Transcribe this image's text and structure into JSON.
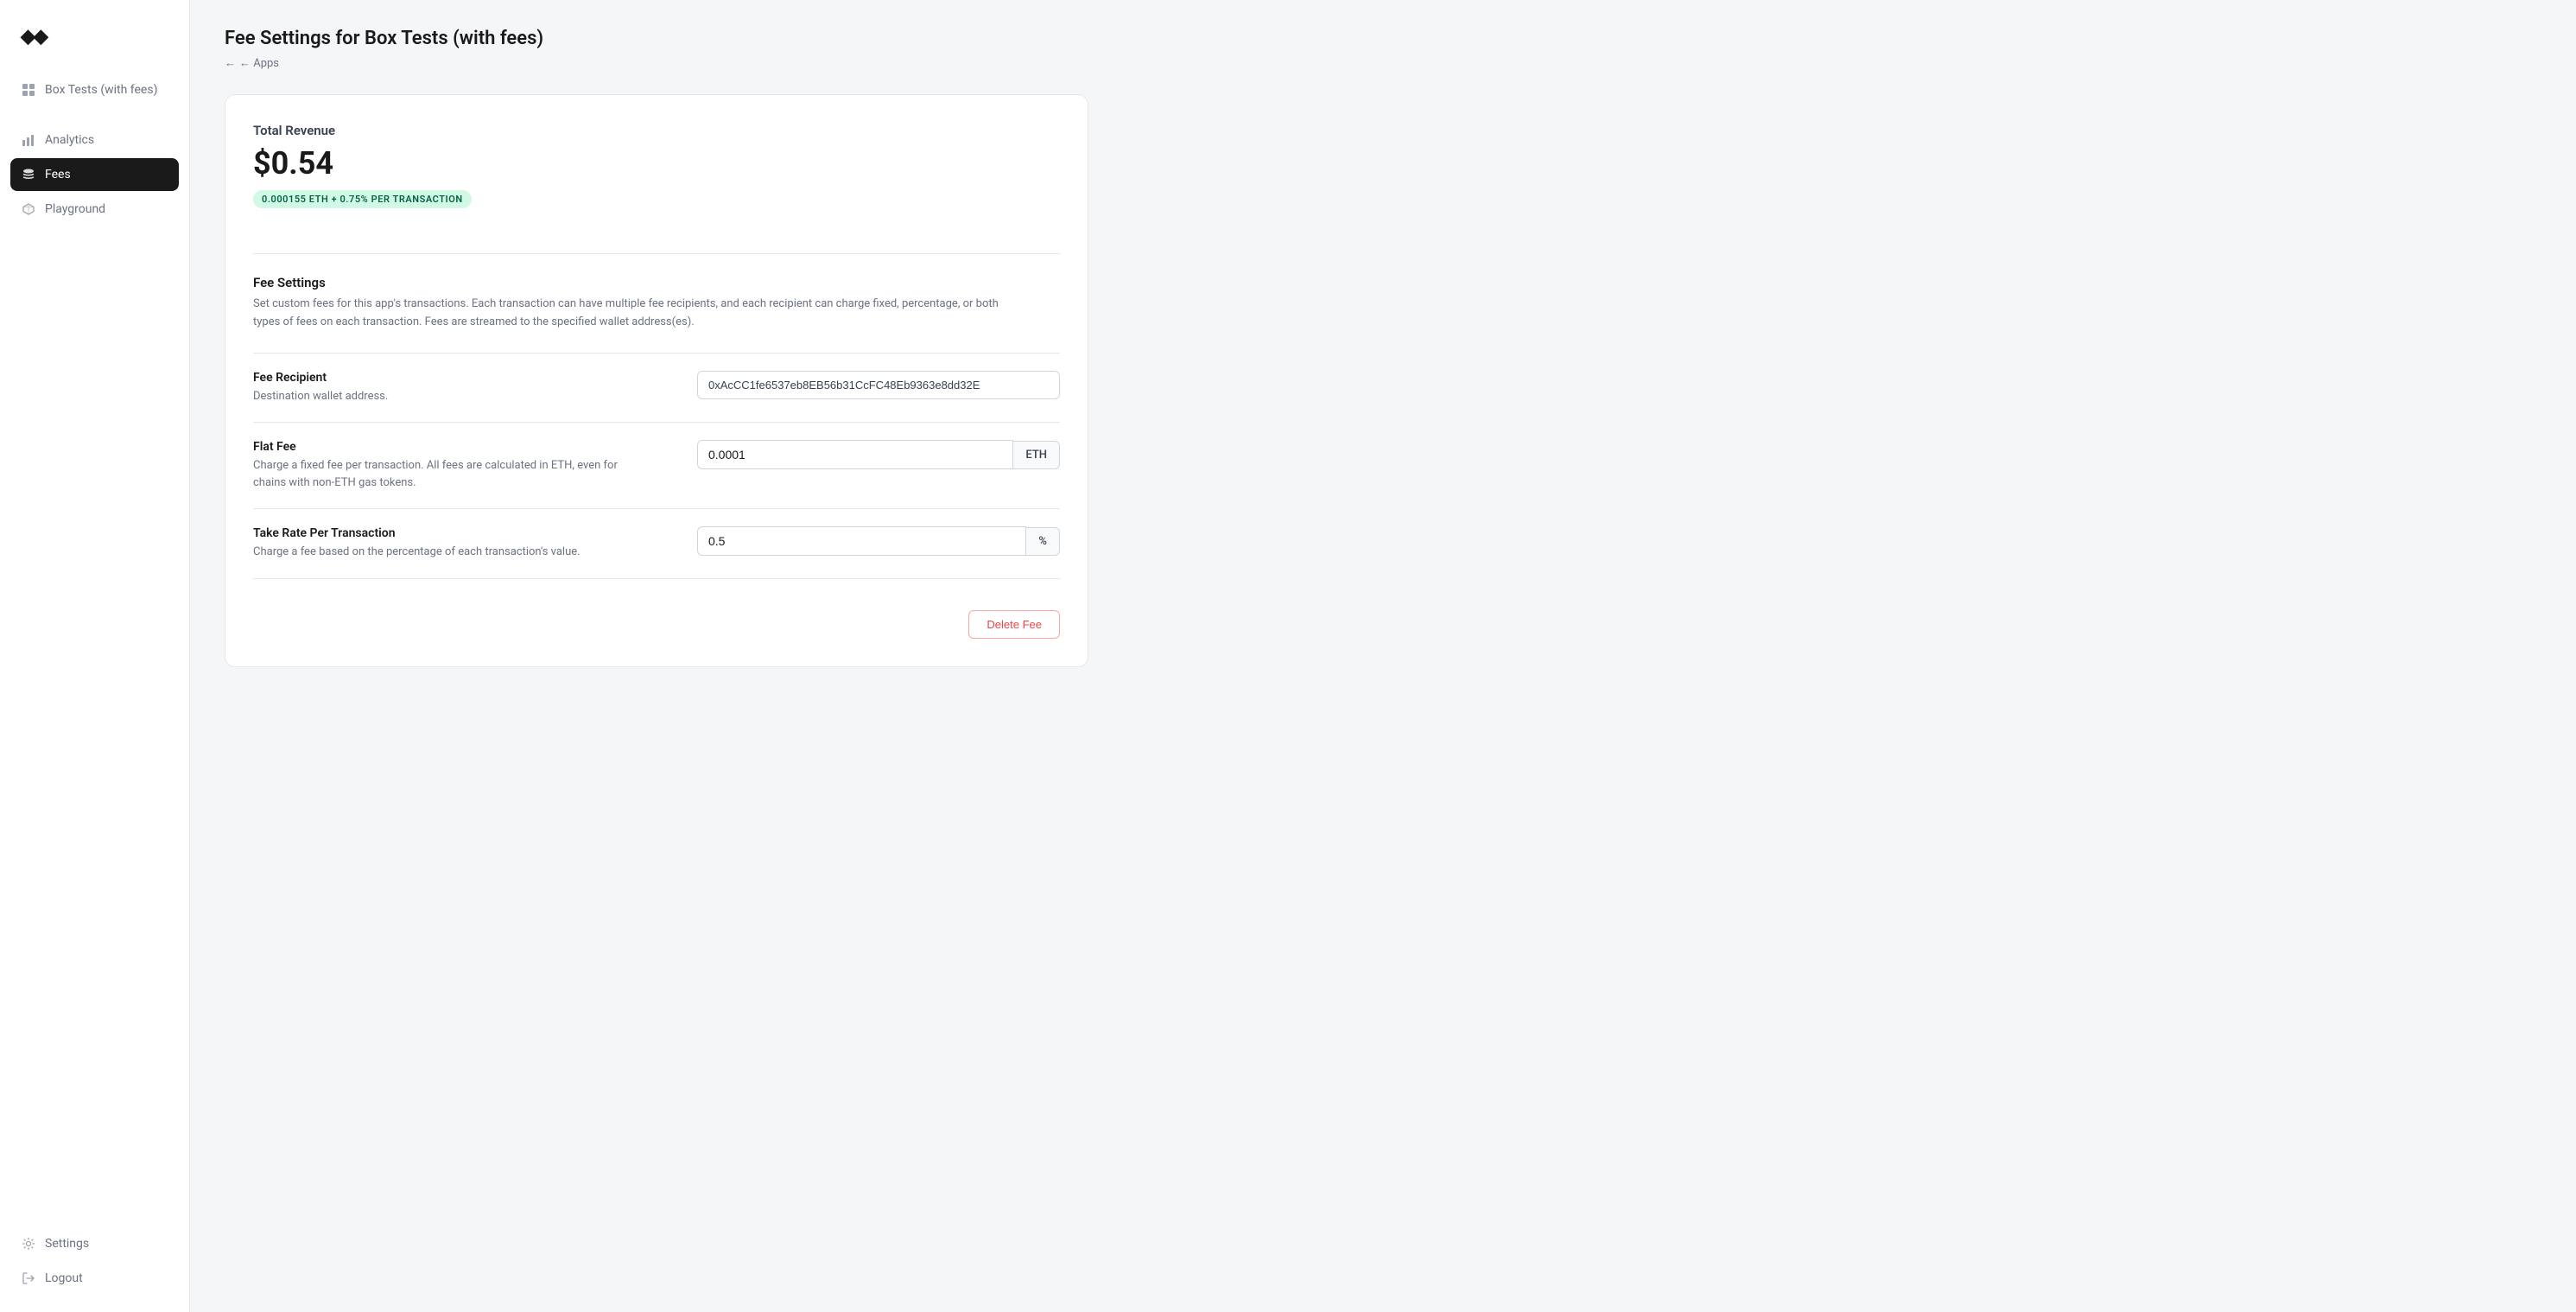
{
  "logo": {
    "symbol": "◆◆"
  },
  "sidebar": {
    "app_name": "Box Tests (with fees)",
    "nav_items": [
      {
        "id": "app",
        "label": "Box Tests (with fees)",
        "icon": "grid",
        "active": false
      },
      {
        "id": "analytics",
        "label": "Analytics",
        "icon": "bar-chart",
        "active": false
      },
      {
        "id": "fees",
        "label": "Fees",
        "icon": "stack",
        "active": true
      },
      {
        "id": "playground",
        "label": "Playground",
        "icon": "cube",
        "active": false
      },
      {
        "id": "settings",
        "label": "Settings",
        "icon": "gear",
        "active": false
      },
      {
        "id": "logout",
        "label": "Logout",
        "icon": "logout",
        "active": false
      }
    ]
  },
  "page": {
    "title": "Fee Settings for Box Tests (with fees)",
    "back_label": "← Apps"
  },
  "revenue": {
    "label": "Total Revenue",
    "amount": "$0.54",
    "badge": "0.000155 ETH + 0.75% PER TRANSACTION"
  },
  "fee_settings": {
    "title": "Fee Settings",
    "description": "Set custom fees for this app's transactions. Each transaction can have multiple fee recipients, and each recipient can charge fixed, percentage, or both types of fees on each transaction. Fees are streamed to the specified wallet address(es)."
  },
  "fee_rows": [
    {
      "id": "recipient",
      "label": "Fee Recipient",
      "sub": "Destination wallet address.",
      "value": "0xAcCC1fe6537eb8EB56b31CcFC48Eb9363e8dd32E",
      "unit": null
    },
    {
      "id": "flat_fee",
      "label": "Flat Fee",
      "sub": "Charge a fixed fee per transaction. All fees are calculated in ETH, even for chains with non-ETH gas tokens.",
      "value": "0.0001",
      "unit": "ETH"
    },
    {
      "id": "take_rate",
      "label": "Take Rate Per Transaction",
      "sub": "Charge a fee based on the percentage of each transaction's value.",
      "value": "0.5",
      "unit": "%"
    }
  ],
  "buttons": {
    "delete_fee": "Delete Fee"
  }
}
